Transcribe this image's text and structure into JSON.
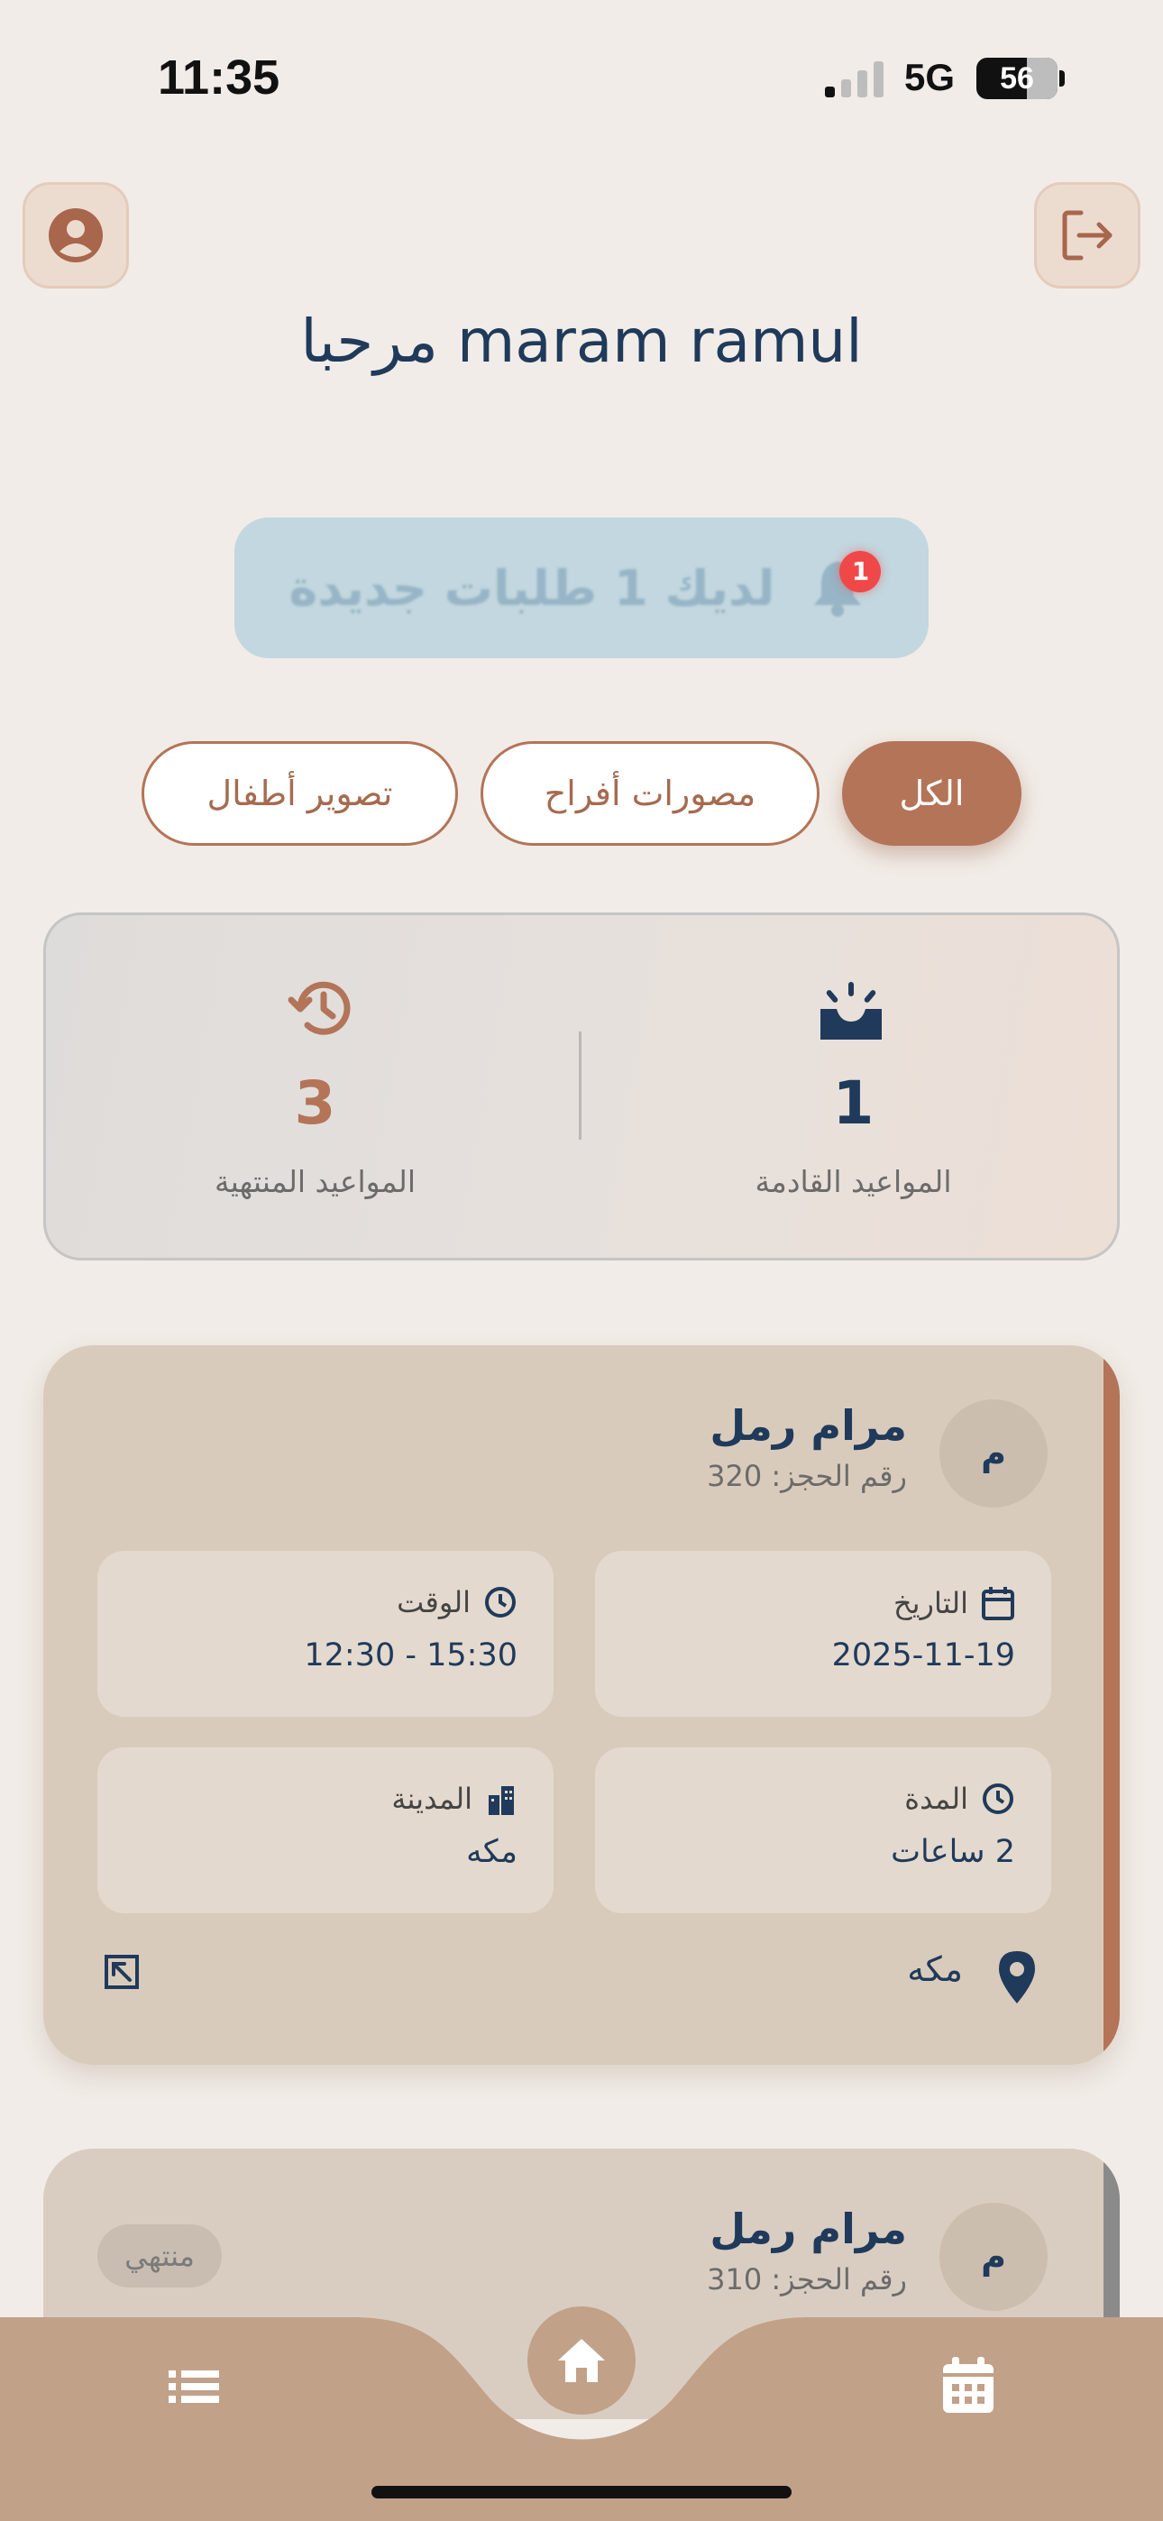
{
  "status_bar": {
    "time": "11:35",
    "network": "5G",
    "battery": "56"
  },
  "header": {
    "welcome": "مرحبا maram ramul"
  },
  "notification": {
    "text": "لديك 1 طلبات جديدة",
    "badge": "1"
  },
  "filters": {
    "tabs": [
      {
        "label": "الكل",
        "active": true
      },
      {
        "label": "مصورات أفراح",
        "active": false
      },
      {
        "label": "تصوير أطفال",
        "active": false
      }
    ]
  },
  "stats": {
    "upcoming": {
      "value": "1",
      "label": "المواعيد القادمة"
    },
    "finished": {
      "value": "3",
      "label": "المواعيد المنتهية"
    }
  },
  "bookings": [
    {
      "avatar_letter": "م",
      "name": "مرام رمل",
      "booking_number": "رقم الحجز: 320",
      "date_label": "التاريخ",
      "date": "2025-11-19",
      "time_label": "الوقت",
      "time": "12:30 - 15:30",
      "duration_label": "المدة",
      "duration": "2 ساعات",
      "city_label": "المدينة",
      "city": "مكه",
      "location": "مكه",
      "accent": "#b37458"
    },
    {
      "avatar_letter": "م",
      "name": "مرام رمل",
      "booking_number": "رقم الحجز: 310",
      "status": "منتهي",
      "accent": "#8a8a8a"
    }
  ],
  "colors": {
    "primary": "#b37458",
    "navy": "#1f3a5a",
    "background": "#f1ece7",
    "nav": "#c2a189"
  }
}
